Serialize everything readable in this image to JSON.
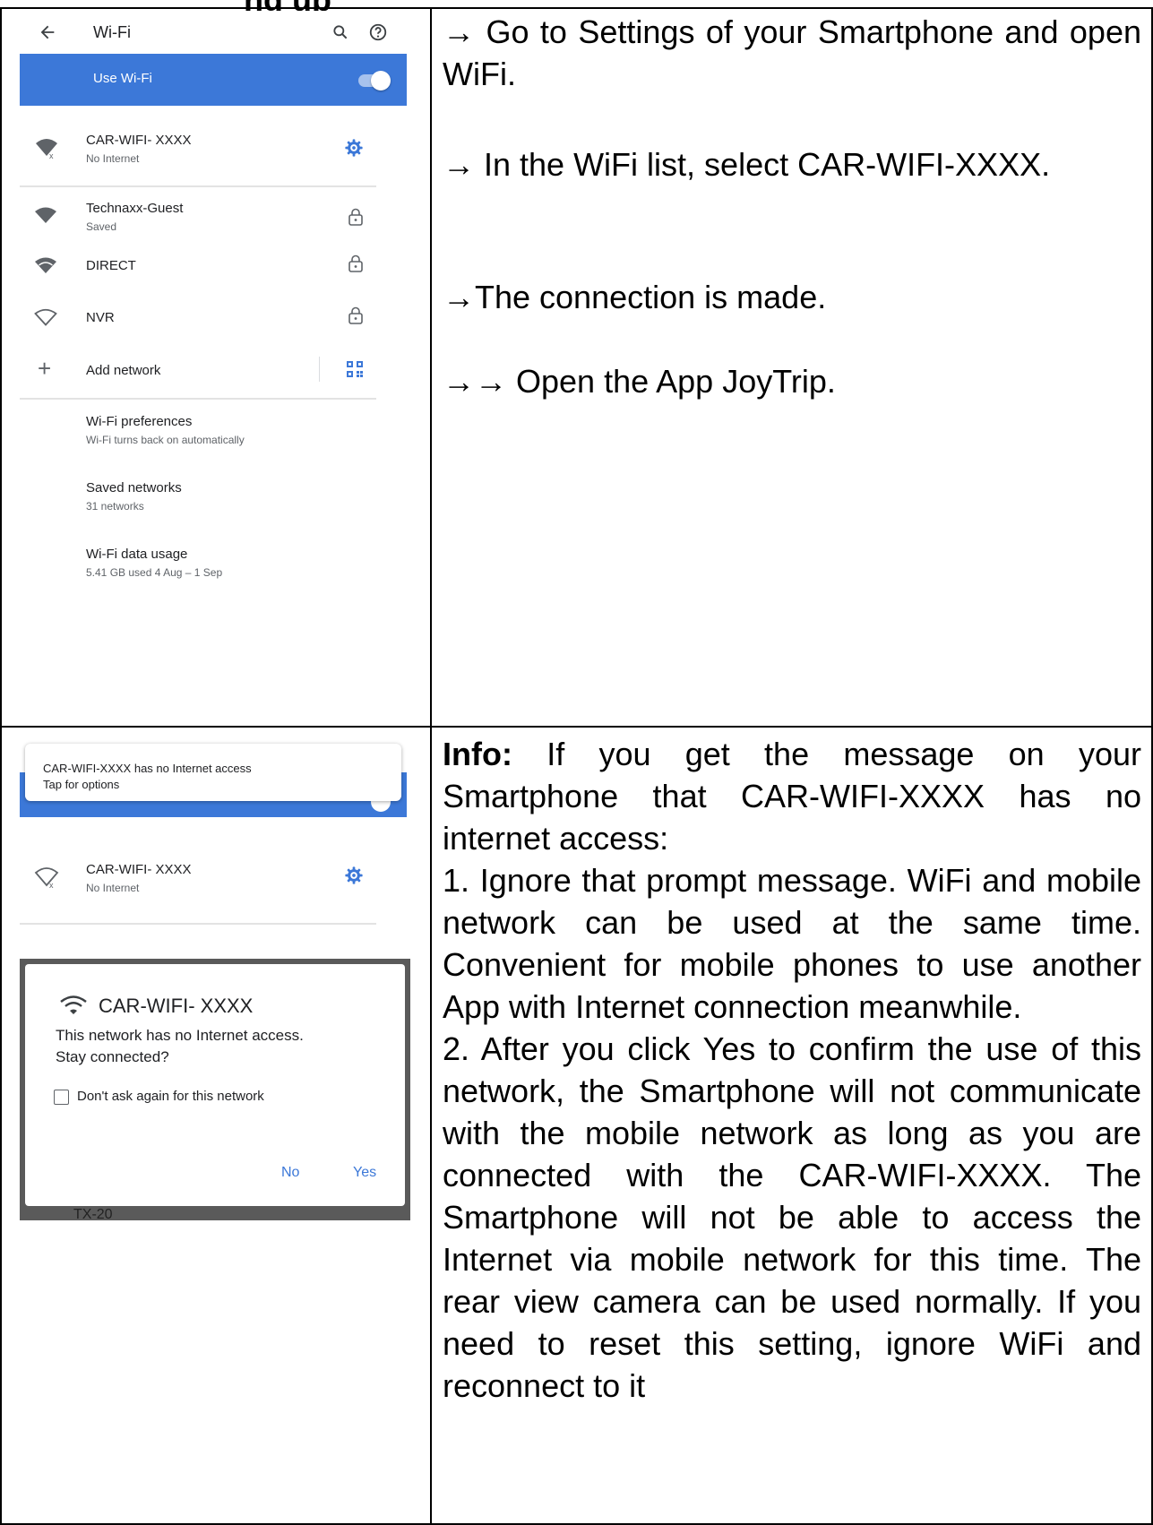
{
  "header_partial": "ng up",
  "wifi_screen": {
    "title": "Wi-Fi",
    "use_wifi_label": "Use Wi-Fi",
    "accent_color": "#3c78d8",
    "networks": [
      {
        "name": "CAR-WIFI- XXXX",
        "status": "No Internet",
        "icon": "wifi-no-internet-icon",
        "action_icon": "gear-icon"
      },
      {
        "name": "Technaxx-Guest",
        "status": "Saved",
        "icon": "wifi-full-icon",
        "action_icon": "lock-icon"
      },
      {
        "name": "DIRECT",
        "status": "",
        "icon": "wifi-full-icon",
        "action_icon": "lock-icon"
      },
      {
        "name": "NVR",
        "status": "",
        "icon": "wifi-outline-icon",
        "action_icon": "lock-icon"
      }
    ],
    "add_network_label": "Add network",
    "settings": [
      {
        "title": "Wi-Fi preferences",
        "subtitle": "Wi-Fi turns back on automatically"
      },
      {
        "title": "Saved networks",
        "subtitle": "31 networks"
      },
      {
        "title": "Wi-Fi data usage",
        "subtitle": "5.41 GB used 4 Aug – 1 Sep"
      }
    ]
  },
  "dialog_screen": {
    "notification_title": "CAR-WIFI-XXXX has no Internet access",
    "notification_subtitle": "Tap for options",
    "network_name": "CAR-WIFI- XXXX",
    "network_status": "No Internet",
    "dialog_title": "CAR-WIFI- XXXX",
    "dialog_message_line1": "This network has no Internet access.",
    "dialog_message_line2": "Stay connected?",
    "checkbox_label": "Don't ask again for this network",
    "no_label": "No",
    "yes_label": "Yes",
    "bottom_partial": "TX-20"
  },
  "instructions": {
    "step1": "→ Go to Settings of your Smartphone and open WiFi.",
    "step2": "→ In the WiFi list, select CAR-WIFI-XXXX.",
    "step3": "→The connection is made.",
    "step4": "→→ Open the App JoyTrip."
  },
  "info": {
    "label": "Info:",
    "intro": " If you get the message on your Smartphone that CAR-WIFI-XXXX has no internet access:",
    "point1": "1. Ignore that prompt message. WiFi and mobile network can be used at the same time. Convenient for mobile phones to use another App with Internet connection meanwhile.",
    "point2": "2. After you click Yes to confirm the use of this network, the Smartphone will not communicate with the mobile network as long as you are connected with the CAR-WIFI-XXXX. The Smartphone will not be able to access the Internet via mobile network for this time. The rear view camera can be used normally. If you need to reset this setting, ignore WiFi and reconnect to it"
  }
}
